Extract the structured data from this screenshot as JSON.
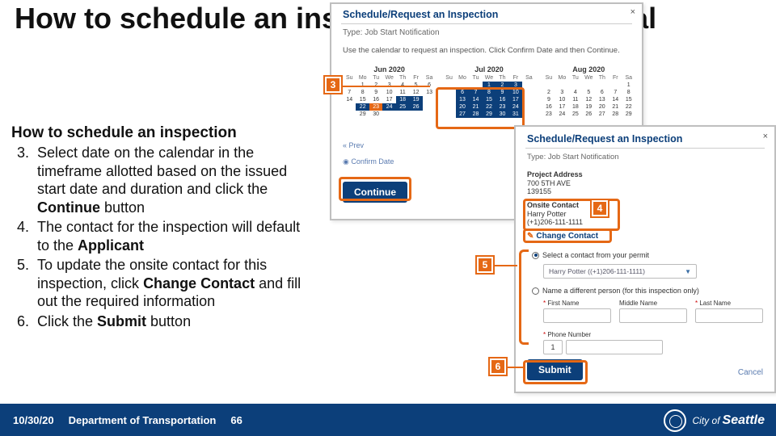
{
  "title": "How to schedule an inspection from the Portal",
  "subtitle": "How to schedule an inspection",
  "steps": [
    {
      "num": "3.",
      "text_pre": "Select date on the calendar in the timeframe allotted based on the issued start date and duration and click the ",
      "bold": "Continue",
      "text_post": " button"
    },
    {
      "num": "4.",
      "text_pre": "The contact for the inspection will default to the ",
      "bold": "Applicant",
      "text_post": ""
    },
    {
      "num": "5.",
      "text_pre": "To update the onsite contact for this inspection, click  ",
      "bold": "Change Contact",
      "text_post": " and fill out the required information"
    },
    {
      "num": "6.",
      "text_pre": "Click the ",
      "bold": "Submit",
      "text_post": " button"
    }
  ],
  "footer": {
    "date": "10/30/20",
    "dept": "Department of Transportation",
    "page": "66",
    "city": "City of Seattle"
  },
  "panel1": {
    "title": "Schedule/Request an Inspection",
    "type": "Type: Job Start Notification",
    "instr": "Use the calendar to request an inspection. Click Confirm Date and then Continue.",
    "months": [
      "Jun 2020",
      "Jul 2020",
      "Aug 2020"
    ],
    "dows": [
      "Su",
      "Mo",
      "Tu",
      "We",
      "Th",
      "Fr",
      "Sa"
    ],
    "prev": "« Prev",
    "confirm": "Confirm Date",
    "continue": "Continue"
  },
  "panel2": {
    "title": "Schedule/Request an Inspection",
    "type": "Type: Job Start Notification",
    "addr_label": "Project Address",
    "addr1": "700 5TH AVE",
    "addr2": "139155",
    "onsite_label": "Onsite Contact",
    "contact_name": "Harry Potter",
    "contact_phone": "(+1)206-111-1111",
    "change": "Change Contact",
    "radio_select": "Select a contact from your permit",
    "select_value": "Harry Potter ((+1)206-111-1111)",
    "radio_name": "Name a different person (for this inspection only)",
    "fn": "First Name",
    "mn": "Middle Name",
    "ln": "Last Name",
    "phone": "Phone Number",
    "phone_prefix": "1",
    "submit": "Submit",
    "cancel": "Cancel"
  },
  "callouts": {
    "c3": "3",
    "c4": "4",
    "c5": "5",
    "c6": "6"
  }
}
